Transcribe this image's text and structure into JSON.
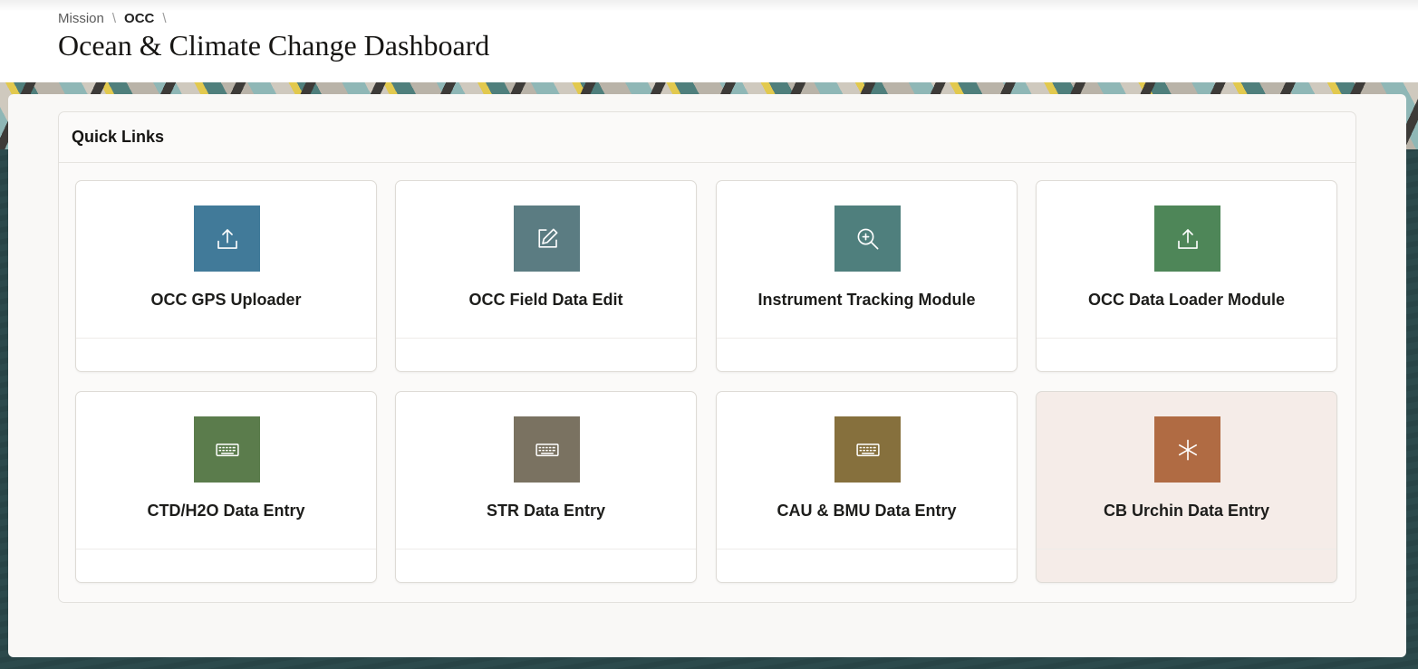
{
  "breadcrumb": {
    "items": [
      "Mission",
      "OCC"
    ]
  },
  "page": {
    "title": "Ocean & Climate Change Dashboard"
  },
  "quick_links": {
    "title": "Quick Links",
    "cards": [
      {
        "label": "OCC GPS Uploader",
        "icon": "upload-icon",
        "color": "#417a99"
      },
      {
        "label": "OCC Field Data Edit",
        "icon": "edit-icon",
        "color": "#5b7c82"
      },
      {
        "label": "Instrument Tracking Module",
        "icon": "zoom-in-icon",
        "color": "#4f7f7d"
      },
      {
        "label": "OCC Data Loader Module",
        "icon": "upload-icon",
        "color": "#4e8658"
      },
      {
        "label": "CTD/H2O Data Entry",
        "icon": "keyboard-icon",
        "color": "#5b7c4c"
      },
      {
        "label": "STR Data Entry",
        "icon": "keyboard-icon",
        "color": "#7a7261"
      },
      {
        "label": "CAU & BMU Data Entry",
        "icon": "keyboard-icon",
        "color": "#86703d"
      },
      {
        "label": "CB Urchin Data Entry",
        "icon": "asterisk-icon",
        "color": "#b06b43"
      }
    ]
  }
}
